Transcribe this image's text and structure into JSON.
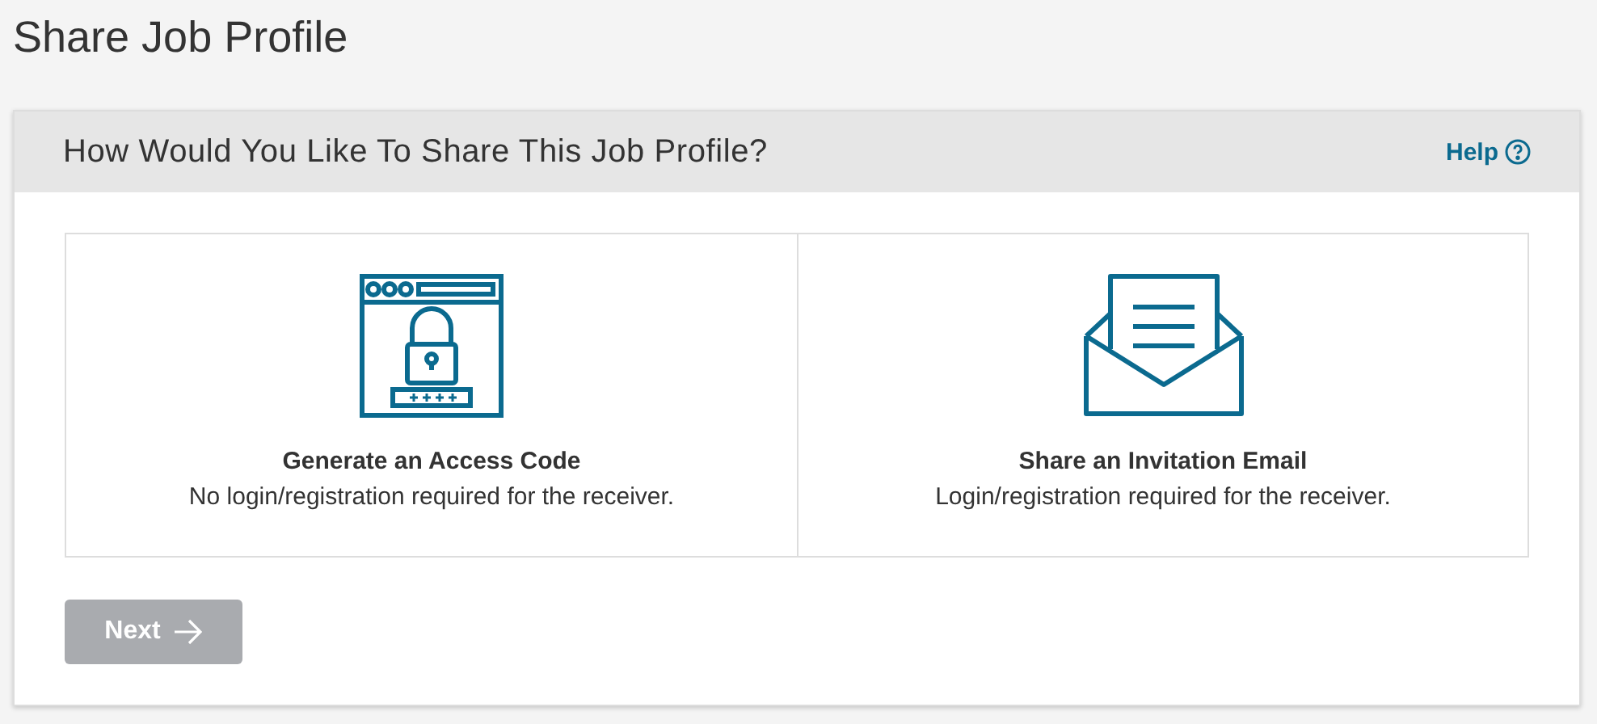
{
  "page_title": "Share Job Profile",
  "panel": {
    "title": "How Would You Like To Share This Job Profile?",
    "help": "Help"
  },
  "options": [
    {
      "kind": "access-code",
      "title": "Generate an Access Code",
      "description": "No login/registration required for the receiver.",
      "selected": false
    },
    {
      "kind": "email",
      "title": "Share an Invitation Email",
      "description": "Login/registration required for the receiver.",
      "selected": false
    }
  ],
  "next_button": {
    "label": "Next",
    "disabled": true
  }
}
